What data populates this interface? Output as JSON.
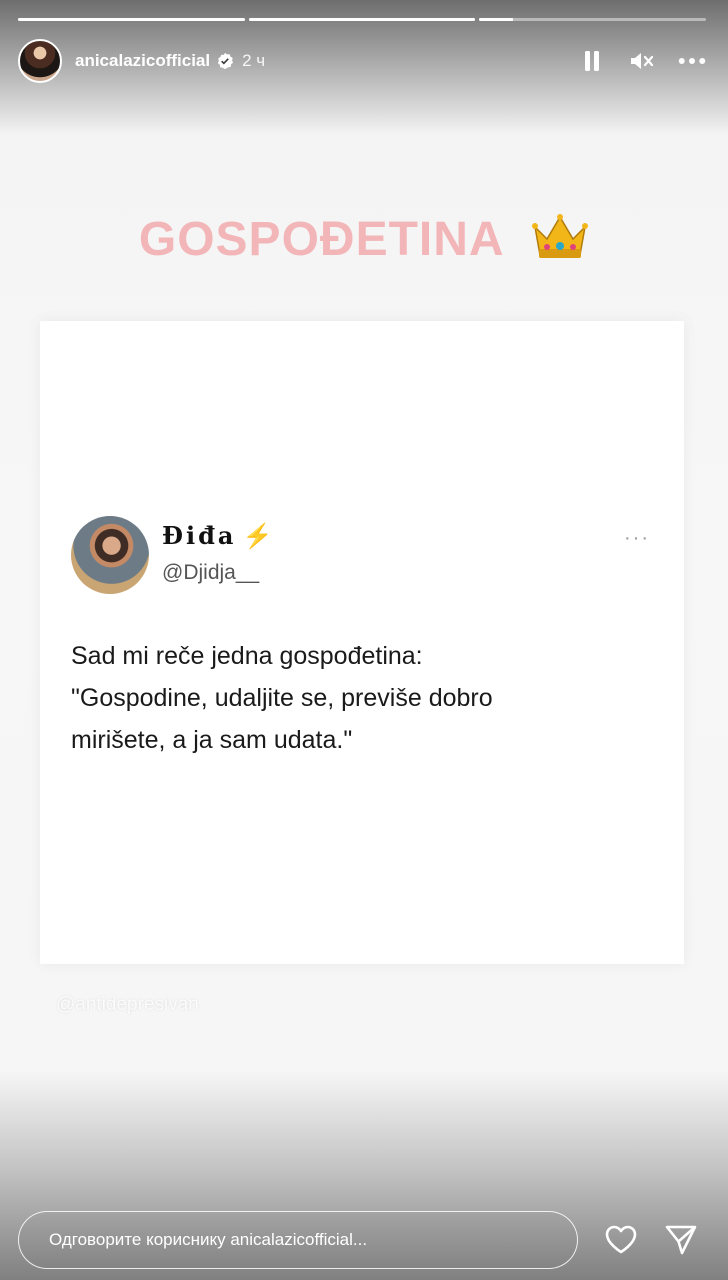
{
  "story": {
    "progress": [
      1.0,
      1.0,
      0.15
    ],
    "username": "anicalazicofficial",
    "timestamp": "2 ч",
    "headline": "GOSPOĐETINA",
    "headline_emoji": "crown-icon",
    "credit": "@antidepresivan",
    "reply_placeholder": "Одговорите кориснику anicalazicofficial..."
  },
  "tweet": {
    "display_name": "Điđa",
    "handle": "@Djidja__",
    "emoji": "⚡",
    "more": "···",
    "lines": [
      "Sad mi reče jedna gospođetina:",
      "\"Gospodine, udaljite se, previše dobro",
      "mirišete, a ja sam udata.\""
    ]
  },
  "colors": {
    "headline": "#f3b6b8",
    "verified": "#ffffff",
    "bolt": "#f5c20a"
  }
}
